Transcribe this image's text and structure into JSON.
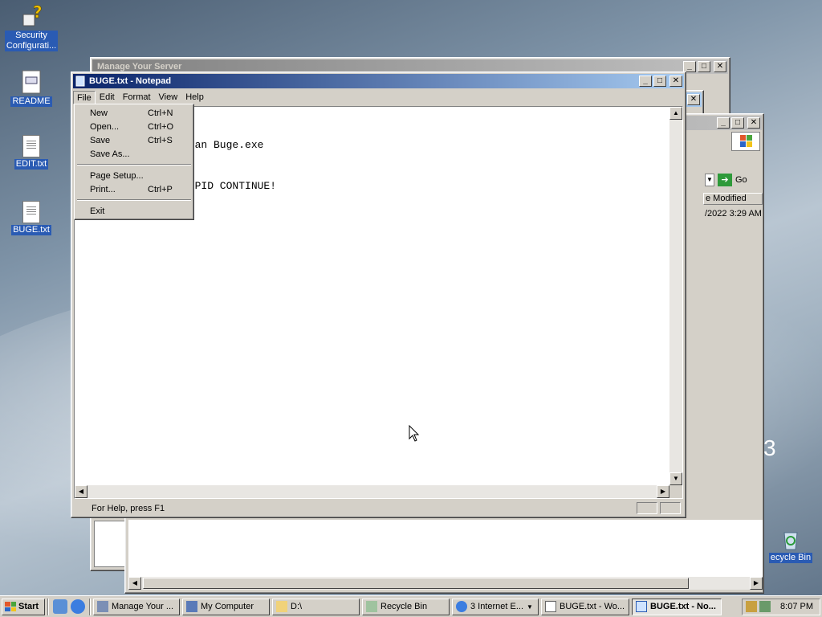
{
  "desktop": {
    "icons": [
      {
        "label": "Security\nConfigurati...",
        "icon": "security-config-icon"
      },
      {
        "label": "README",
        "icon": "wordpad-document-icon"
      },
      {
        "label": "EDIT.txt",
        "icon": "text-file-icon"
      },
      {
        "label": "BUGE.txt",
        "icon": "text-file-icon"
      },
      {
        "label": "ecycle Bin",
        "icon": "recycle-bin-icon"
      }
    ],
    "fragment_text": "3"
  },
  "background_windows": {
    "manage_server_title": "Manage Your Server",
    "explorer_go_label": "Go",
    "explorer_column": "e Modified",
    "explorer_row_date": "/2022 3:29 AM"
  },
  "notepad": {
    "title": "BUGE.txt - Notepad",
    "menu": [
      "File",
      "Edit",
      "Format",
      "View",
      "Help"
    ],
    "text_lines": [
      "",
      "",
      "ojan Buge.exe",
      "",
      "",
      "TUPID CONTINUE!"
    ],
    "status": "For Help, press F1"
  },
  "file_menu": {
    "items": [
      {
        "label": "New",
        "shortcut": "Ctrl+N"
      },
      {
        "label": "Open...",
        "shortcut": "Ctrl+O"
      },
      {
        "label": "Save",
        "shortcut": "Ctrl+S"
      },
      {
        "label": "Save As...",
        "shortcut": ""
      },
      {
        "label": "Page Setup...",
        "shortcut": ""
      },
      {
        "label": "Print...",
        "shortcut": "Ctrl+P"
      },
      {
        "label": "Exit",
        "shortcut": ""
      }
    ]
  },
  "taskbar": {
    "start_label": "Start",
    "buttons": [
      {
        "label": "Manage Your ...",
        "icon": "server-icon"
      },
      {
        "label": "My Computer",
        "icon": "computer-icon"
      },
      {
        "label": "D:\\",
        "icon": "folder-icon"
      },
      {
        "label": "Recycle Bin",
        "icon": "recycle-bin-icon"
      },
      {
        "label": "3 Internet E...",
        "icon": "internet-explorer-icon"
      },
      {
        "label": "BUGE.txt - Wo...",
        "icon": "wordpad-icon"
      },
      {
        "label": "BUGE.txt - No...",
        "icon": "notepad-icon"
      }
    ],
    "clock": "8:07 PM"
  },
  "colors": {
    "title_active": "#0a246a",
    "title_active_end": "#a6caf0",
    "menu_highlight": "#0a246a",
    "face": "#d4d0c8"
  }
}
